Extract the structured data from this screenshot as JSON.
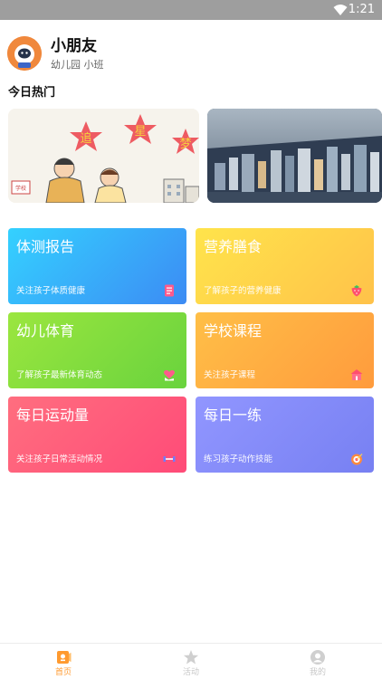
{
  "status_bar": {
    "time": "1:21",
    "wifi_icon": "wifi-icon"
  },
  "profile": {
    "name": "小朋友",
    "subtitle": "幼儿园 小班",
    "avatar_icon": "astronaut-avatar"
  },
  "section": {
    "title": "今日热门"
  },
  "banners": [
    {
      "text_1": "追",
      "text_2": "星",
      "text_3": "梦",
      "sign": "学校"
    },
    {
      "icon": "city-aerial-photo"
    }
  ],
  "cards": [
    {
      "title": "体测报告",
      "desc": "关注孩子体质健康",
      "icon": "report-icon"
    },
    {
      "title": "营养膳食",
      "desc": "了解孩子的营养健康",
      "icon": "strawberry-icon"
    },
    {
      "title": "幼儿体育",
      "desc": "了解孩子最新体育动态",
      "icon": "heart-hand-icon"
    },
    {
      "title": "学校课程",
      "desc": "关注孩子课程",
      "icon": "school-icon"
    },
    {
      "title": "每日运动量",
      "desc": "关注孩子日常活动情况",
      "icon": "dumbbell-icon"
    },
    {
      "title": "每日一练",
      "desc": "练习孩子动作技能",
      "icon": "target-icon"
    }
  ],
  "tabbar": {
    "items": [
      {
        "label": "首页",
        "icon": "home-icon",
        "active": true
      },
      {
        "label": "活动",
        "icon": "star-icon",
        "active": false
      },
      {
        "label": "我的",
        "icon": "profile-icon",
        "active": false
      }
    ]
  },
  "colors": {
    "accent": "#ff9a2f",
    "inactive": "#c8c8c8"
  }
}
